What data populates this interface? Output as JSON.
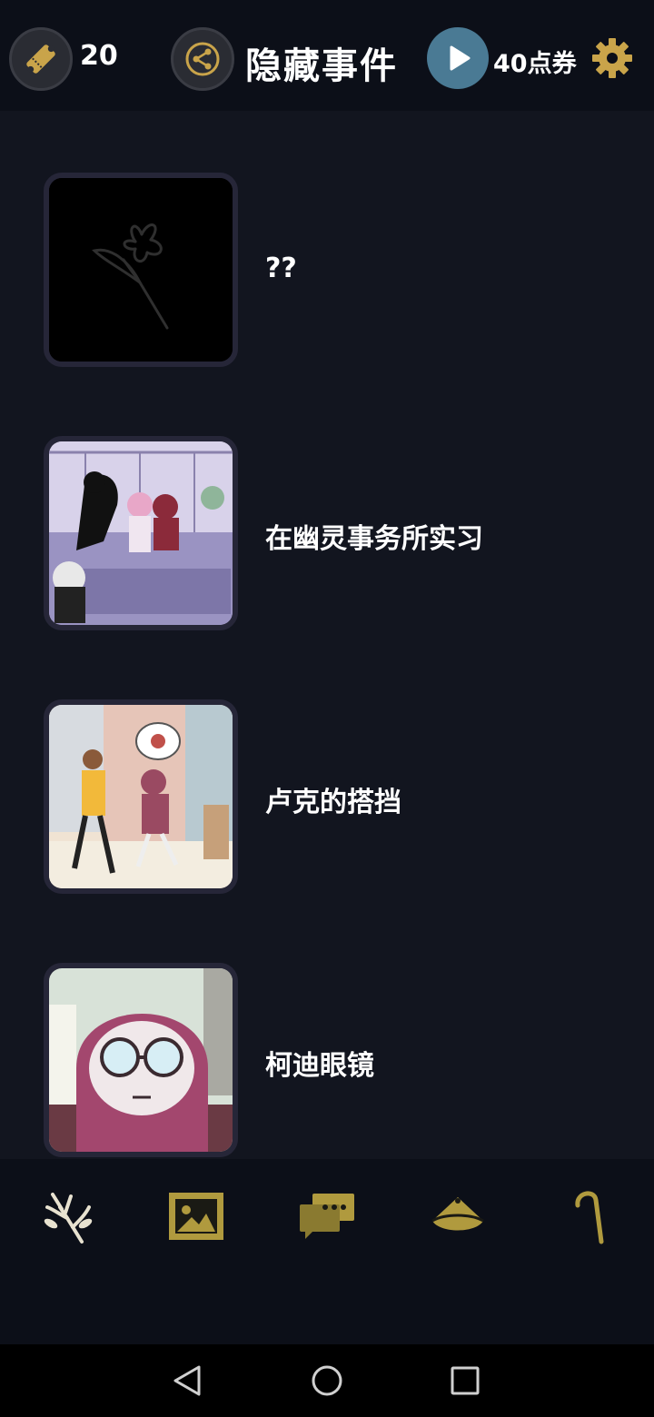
{
  "header": {
    "ticket_icon": "ticket-icon",
    "ticket_count": "20",
    "share_icon": "share-icon",
    "title": "隐藏事件",
    "play_icon": "play-icon",
    "coupon_text": "40点券",
    "settings_icon": "gear-icon",
    "accent_color": "#c9a44a"
  },
  "events": [
    {
      "label": "??",
      "thumbnail": "locked-flower-silhouette"
    },
    {
      "label": "在幽灵事务所实习",
      "thumbnail": "ghost-office-scene"
    },
    {
      "label": "卢克的搭挡",
      "thumbnail": "street-partner-scene"
    },
    {
      "label": "柯迪眼镜",
      "thumbnail": "glasses-character-closeup"
    }
  ],
  "tabs": [
    {
      "icon": "flower-branch-icon",
      "active": true
    },
    {
      "icon": "gallery-icon",
      "active": false
    },
    {
      "icon": "chat-bubbles-icon",
      "active": false
    },
    {
      "icon": "hat-icon",
      "active": false
    },
    {
      "icon": "cane-icon",
      "active": false
    }
  ],
  "system_nav": [
    "back-icon",
    "home-icon",
    "recents-icon"
  ]
}
